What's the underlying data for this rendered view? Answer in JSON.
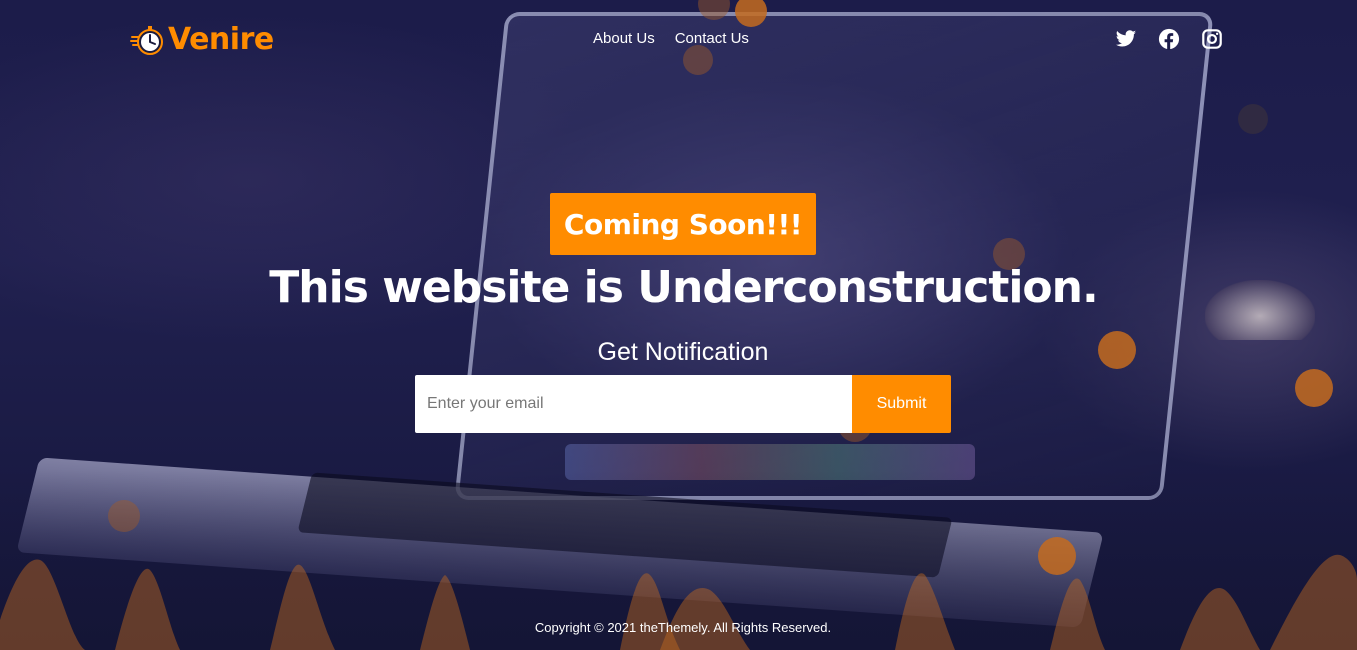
{
  "brand": {
    "name": "Venire",
    "logo_icon": "stopwatch-icon",
    "accent": "#ff8c00"
  },
  "nav": {
    "items": [
      {
        "label": "About Us"
      },
      {
        "label": "Contact Us"
      }
    ]
  },
  "social": [
    {
      "icon": "twitter-icon"
    },
    {
      "icon": "facebook-icon"
    },
    {
      "icon": "instagram-icon"
    }
  ],
  "hero": {
    "badge": "Coming Soon!!!",
    "headline": "This website is Underconstruction.",
    "subtitle": "Get Notification"
  },
  "subscribe": {
    "placeholder": "Enter your email",
    "value": "",
    "button_label": "Submit"
  },
  "footer": {
    "text": "Copyright © 2021 theThemely. All Rights Reserved."
  },
  "colors": {
    "overlay": "#17183f",
    "accent": "#ff8c00",
    "bubble": "#c46b1e"
  }
}
